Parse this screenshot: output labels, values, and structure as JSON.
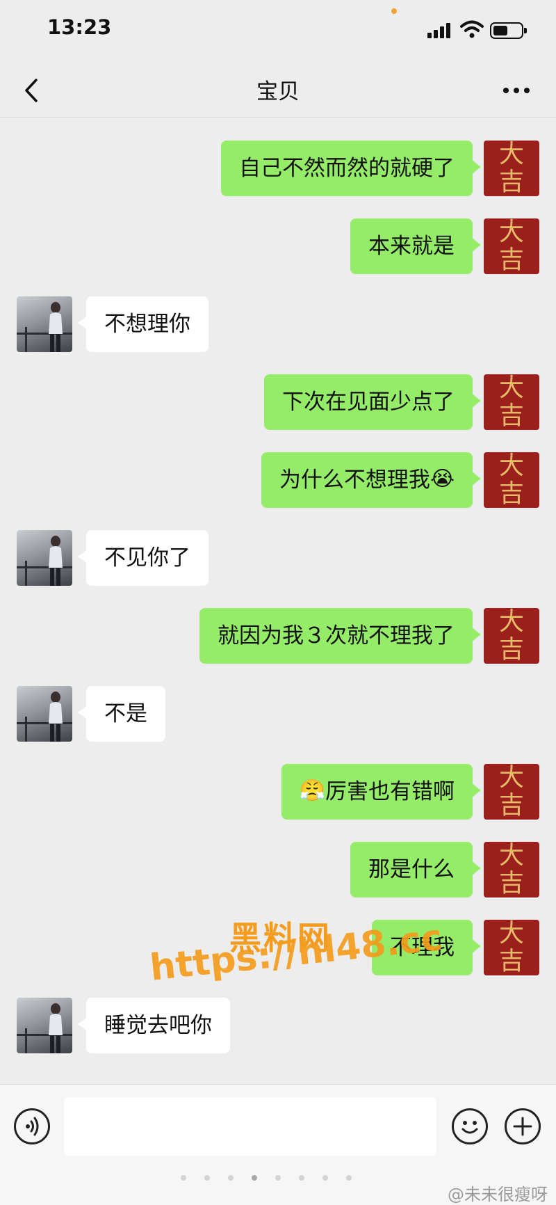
{
  "status_bar": {
    "time": "13:23"
  },
  "nav": {
    "title": "宝贝"
  },
  "my_avatar": {
    "char1": "大",
    "char2": "吉"
  },
  "messages": [
    {
      "side": "right",
      "text": "自己不然而然的就硬了"
    },
    {
      "side": "right",
      "text": "本来就是"
    },
    {
      "side": "left",
      "text": "不想理你"
    },
    {
      "side": "right",
      "text": "下次在见面少点了"
    },
    {
      "side": "right",
      "text": "为什么不想理我",
      "emoji_after": "😭",
      "emoji_name": "crying-emoji"
    },
    {
      "side": "left",
      "text": "不见你了"
    },
    {
      "side": "right",
      "text": "就因为我３次就不理我了"
    },
    {
      "side": "left",
      "text": "不是"
    },
    {
      "side": "right",
      "text": "厉害也有错啊",
      "emoji_before": "😤",
      "emoji_name": "huffing-emoji"
    },
    {
      "side": "right",
      "text": "那是什么"
    },
    {
      "side": "right",
      "text": "不理我"
    },
    {
      "side": "left",
      "text": "睡觉去吧你"
    }
  ],
  "watermark": {
    "title": "黑料网",
    "url": "https://hl48.cc"
  },
  "input": {
    "placeholder": ""
  },
  "credit": "@未未很瘦呀",
  "colors": {
    "my_bubble": "#95ec69",
    "their_bubble": "#ffffff",
    "avatar_red": "#9b1f1a",
    "watermark": "#f39c1d"
  }
}
